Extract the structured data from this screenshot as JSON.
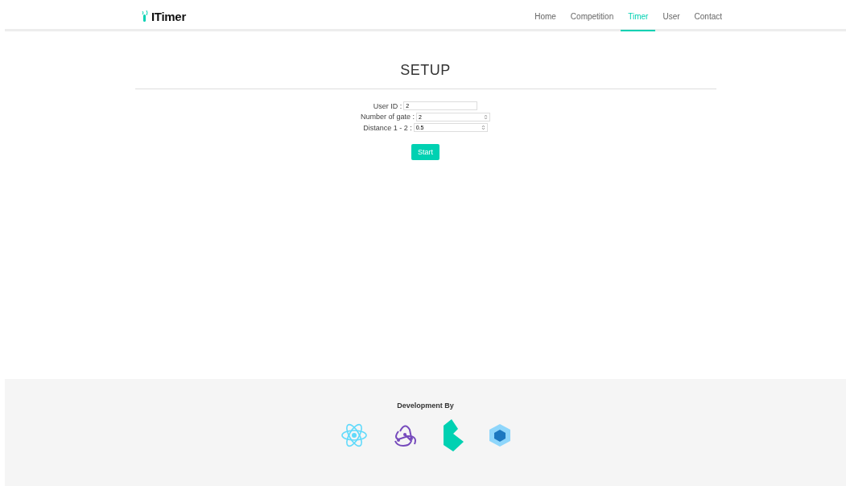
{
  "brand": {
    "name": "ITimer"
  },
  "nav": [
    {
      "label": "Home",
      "selected": false
    },
    {
      "label": "Competition",
      "selected": false
    },
    {
      "label": "Timer",
      "selected": true
    },
    {
      "label": "User",
      "selected": false
    },
    {
      "label": "Contact",
      "selected": false
    }
  ],
  "setup": {
    "title": "SETUP",
    "fields": [
      {
        "label": "User ID :",
        "value": "2",
        "kind": "text"
      },
      {
        "label": "Number of gate :",
        "value": "2",
        "kind": "number"
      },
      {
        "label": "Distance 1 - 2 :",
        "value": "0.5",
        "kind": "number"
      }
    ],
    "button": "Start"
  },
  "footer": {
    "heading": "Development By"
  }
}
